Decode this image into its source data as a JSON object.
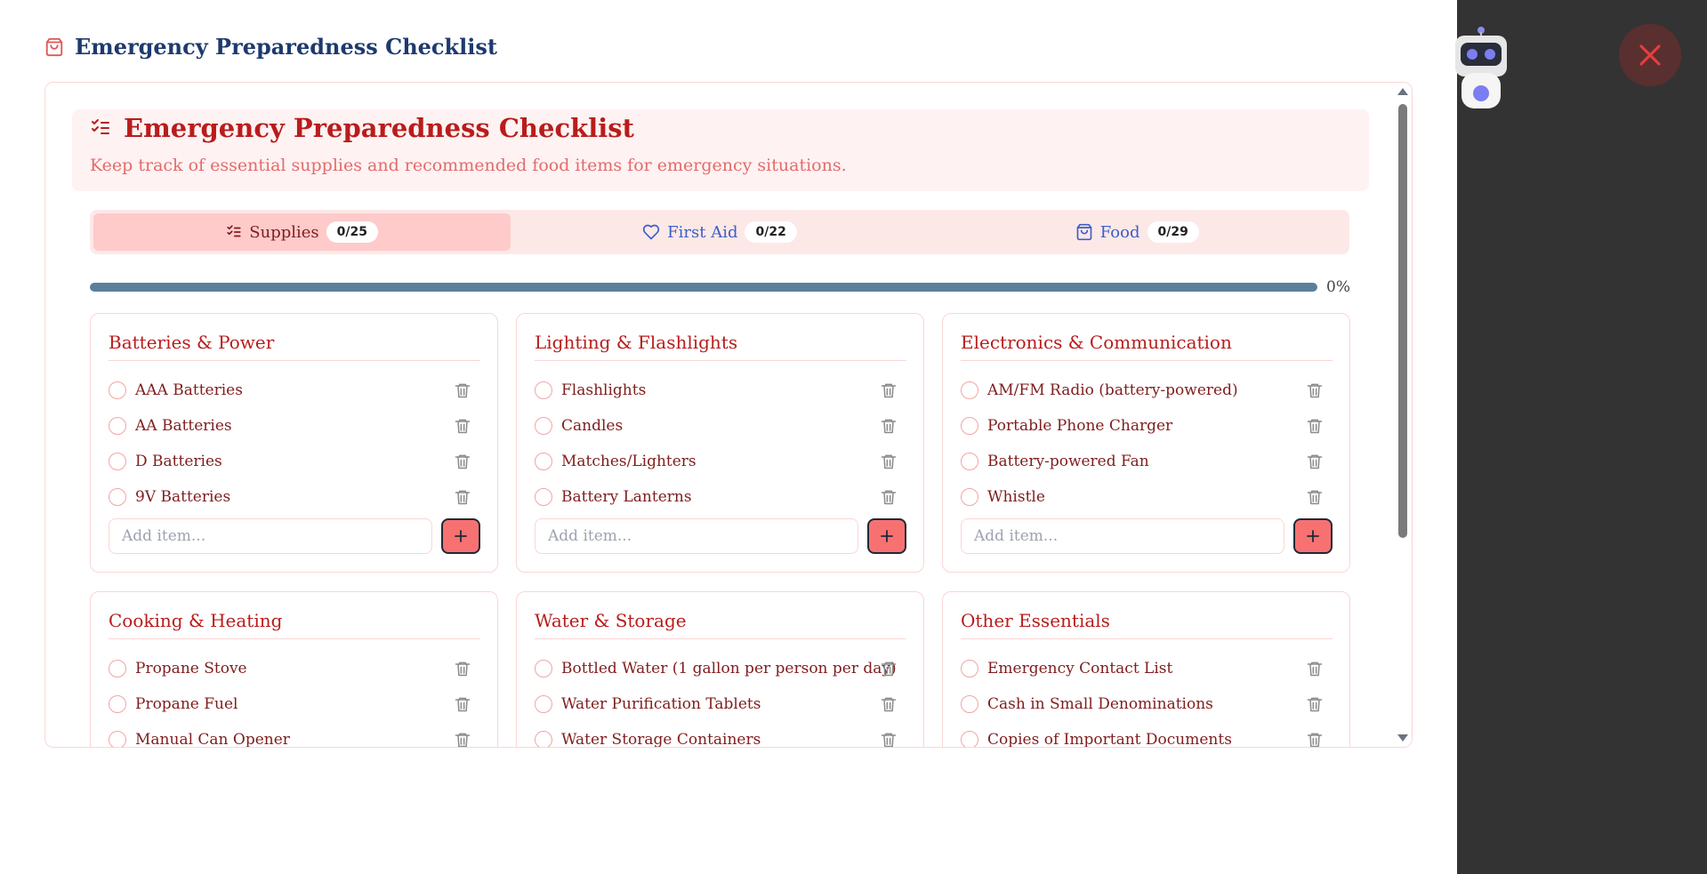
{
  "page": {
    "title": "Emergency Preparedness Checklist"
  },
  "hero": {
    "title": "Emergency Preparedness Checklist",
    "subtitle": "Keep track of essential supplies and recommended food items for emergency situations."
  },
  "tabs": [
    {
      "label": "Supplies",
      "count": "0/25",
      "icon": "checklist-icon",
      "active": true
    },
    {
      "label": "First Aid",
      "count": "0/22",
      "icon": "heart-icon",
      "active": false
    },
    {
      "label": "Food",
      "count": "0/29",
      "icon": "shopping-bag-icon",
      "active": false
    }
  ],
  "progress": {
    "percent_label": "0%",
    "value": 0
  },
  "add_placeholder": "Add item...",
  "categories": [
    {
      "title": "Batteries & Power",
      "items": [
        "AAA Batteries",
        "AA Batteries",
        "D Batteries",
        "9V Batteries"
      ]
    },
    {
      "title": "Lighting & Flashlights",
      "items": [
        "Flashlights",
        "Candles",
        "Matches/Lighters",
        "Battery Lanterns"
      ]
    },
    {
      "title": "Electronics & Communication",
      "items": [
        "AM/FM Radio (battery-powered)",
        "Portable Phone Charger",
        "Battery-powered Fan",
        "Whistle"
      ]
    },
    {
      "title": "Cooking & Heating",
      "items": [
        "Propane Stove",
        "Propane Fuel",
        "Manual Can Opener"
      ]
    },
    {
      "title": "Water & Storage",
      "items": [
        "Bottled Water (1 gallon per person per day)",
        "Water Purification Tablets",
        "Water Storage Containers"
      ]
    },
    {
      "title": "Other Essentials",
      "items": [
        "Emergency Contact List",
        "Cash in Small Denominations",
        "Copies of Important Documents"
      ]
    }
  ],
  "colors": {
    "accent": "#b91c1c",
    "heading": "#1e3a6e",
    "tab_link": "#3b5fc4",
    "add_button": "#f87171",
    "overlay": "#333333"
  }
}
